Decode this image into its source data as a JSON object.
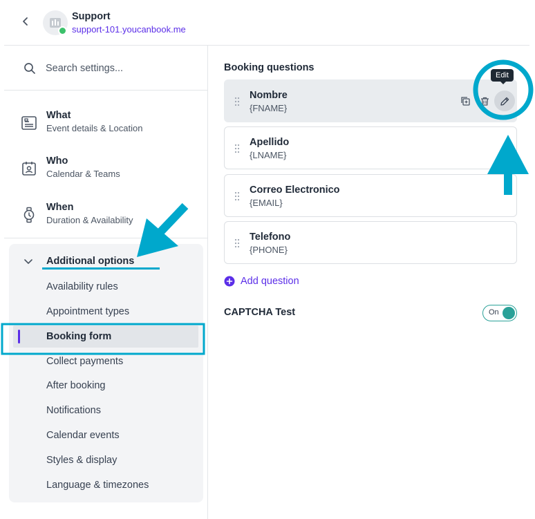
{
  "header": {
    "back_icon": "chevron-left-icon",
    "avatar_icon": "calendar-logo-icon",
    "title": "Support",
    "url": "support-101.youcanbook.me"
  },
  "sidebar": {
    "search": {
      "placeholder": "Search settings...",
      "value": "",
      "icon": "search-icon"
    },
    "nav": [
      {
        "title": "What",
        "subtitle": "Event details & Location",
        "icon": "document-icon"
      },
      {
        "title": "Who",
        "subtitle": "Calendar & Teams",
        "icon": "calendar-person-icon"
      },
      {
        "title": "When",
        "subtitle": "Duration & Availability",
        "icon": "watch-icon"
      }
    ],
    "additional": {
      "title": "Additional options",
      "expanded": true,
      "items": [
        {
          "label": "Availability rules"
        },
        {
          "label": "Appointment types"
        },
        {
          "label": "Booking form",
          "active": true
        },
        {
          "label": "Collect payments"
        },
        {
          "label": "After booking"
        },
        {
          "label": "Notifications"
        },
        {
          "label": "Calendar events"
        },
        {
          "label": "Styles & display"
        },
        {
          "label": "Language & timezones"
        }
      ]
    }
  },
  "main": {
    "section_title": "Booking questions",
    "questions": [
      {
        "label": "Nombre",
        "token": "{FNAME}"
      },
      {
        "label": "Apellido",
        "token": "{LNAME}"
      },
      {
        "label": "Correo Electronico",
        "token": "{EMAIL}"
      },
      {
        "label": "Telefono",
        "token": "{PHONE}"
      }
    ],
    "tooltip": "Edit",
    "add_question": "Add question",
    "captcha": {
      "label": "CAPTCHA Test",
      "toggle_text": "On",
      "enabled": true
    }
  },
  "colors": {
    "accent": "#5b2ee8",
    "toggle": "#2aa198",
    "annotation": "#00a8cc",
    "online": "#3cc16b"
  }
}
